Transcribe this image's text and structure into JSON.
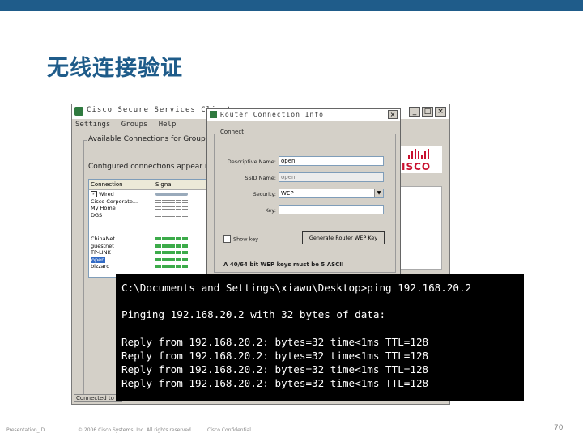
{
  "slide": {
    "title": "无线连接验证",
    "footer_left": "Presentation_ID",
    "footer_copyright": "© 2006 Cisco Systems, Inc. All rights reserved.",
    "footer_confidential": "Cisco Confidential",
    "page_number": "70"
  },
  "client_window": {
    "title": "Cisco Secure Services Client",
    "menu": [
      "Settings",
      "Groups",
      "Help"
    ],
    "buttons": {
      "minimize": "_",
      "maximize": "□",
      "close": "×"
    },
    "group_title": "Available Connections for Group '(",
    "configured_label": "Configured connections appear in",
    "list_columns": {
      "connection": "Connection",
      "signal": "Signal"
    },
    "connections": [
      {
        "name": "Wired",
        "checked": true,
        "signal": "ethernet"
      },
      {
        "name": "Cisco Corporate...",
        "signal": "gray"
      },
      {
        "name": "My Home",
        "signal": "gray"
      },
      {
        "name": "DGS",
        "signal": "gray"
      },
      {
        "name": "ChinaNet",
        "signal": "green"
      },
      {
        "name": "guestnet",
        "signal": "green"
      },
      {
        "name": "TP-LINK",
        "signal": "green"
      },
      {
        "name": "open",
        "signal": "green",
        "selected": true
      },
      {
        "name": "bizzard",
        "signal": "green"
      }
    ],
    "status": "Connected to",
    "logo_text": "ISCO"
  },
  "router_dialog": {
    "title": "Router Connection Info",
    "close_label": "×",
    "group_title": "Connect",
    "fields": {
      "descriptive_name_label": "Descriptive Name:",
      "descriptive_name_value": "open",
      "ssid_label": "SSID Name:",
      "ssid_value": "open",
      "security_label": "Security:",
      "security_value": "WEP",
      "key_label": "Key:",
      "key_value": ""
    },
    "show_key_label": "Show key",
    "generate_button": "Generate Router WEP Key",
    "note": "A 40/64 bit WEP keys must be 5 ASCII"
  },
  "terminal": {
    "lines": [
      "C:\\Documents and Settings\\xiawu\\Desktop>ping 192.168.20.2",
      "Pinging 192.168.20.2 with 32 bytes of data:",
      "Reply from 192.168.20.2: bytes=32 time<1ms TTL=128",
      "Reply from 192.168.20.2: bytes=32 time<1ms TTL=128",
      "Reply from 192.168.20.2: bytes=32 time<1ms TTL=128",
      "Reply from 192.168.20.2: bytes=32 time<1ms TTL=128"
    ]
  },
  "colors": {
    "brand_blue": "#1f5c8a",
    "cisco_red": "#c8102e",
    "signal_green": "#3cab4a"
  }
}
